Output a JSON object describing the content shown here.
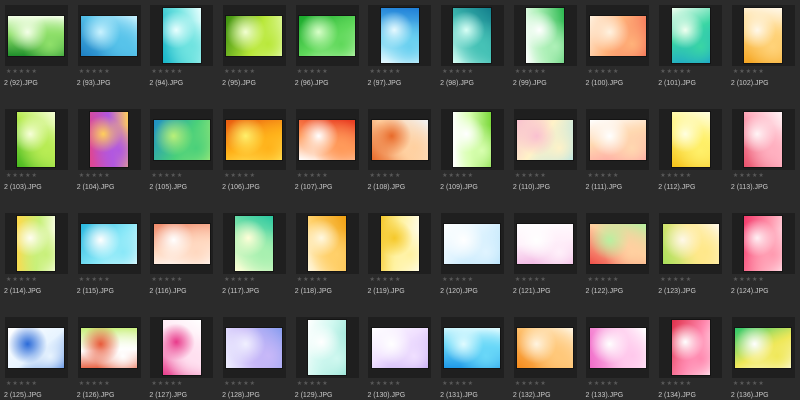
{
  "thumbnails": [
    {
      "name": "2 (92).JPG",
      "o": "l",
      "c": [
        "#1f8f2b",
        "#8fe06a",
        "#f4ffe8"
      ]
    },
    {
      "name": "2 (93).JPG",
      "o": "l",
      "c": [
        "#1d7fc4",
        "#57c3ea",
        "#c9f2ff"
      ]
    },
    {
      "name": "2 (94).JPG",
      "o": "p",
      "c": [
        "#16b5c9",
        "#6fe3e0",
        "#e8ffff"
      ]
    },
    {
      "name": "2 (95).JPG",
      "o": "l",
      "c": [
        "#3c8f10",
        "#b9e83a",
        "#f2ffd0"
      ]
    },
    {
      "name": "2 (96).JPG",
      "o": "l",
      "c": [
        "#17a82a",
        "#5fd85a",
        "#d8ffc8"
      ]
    },
    {
      "name": "2 (97).JPG",
      "o": "p",
      "c": [
        "#1f7fd8",
        "#6ad0f0",
        "#e6f9ff"
      ]
    },
    {
      "name": "2 (98).JPG",
      "o": "p",
      "c": [
        "#127f8c",
        "#46c2b6",
        "#d8fff6"
      ]
    },
    {
      "name": "2 (99).JPG",
      "o": "p",
      "c": [
        "#2ab84e",
        "#aef0b8",
        "#ffffff"
      ]
    },
    {
      "name": "2 (100).JPG",
      "o": "l",
      "c": [
        "#f05a4a",
        "#ffb27a",
        "#fff2e0"
      ]
    },
    {
      "name": "2 (101).JPG",
      "o": "p",
      "c": [
        "#1496d6",
        "#3ad6a4",
        "#f0fff0"
      ]
    },
    {
      "name": "2 (102).JPG",
      "o": "p",
      "c": [
        "#f5a623",
        "#ffd37a",
        "#fff8ea"
      ]
    },
    {
      "name": "2 (103).JPG",
      "o": "p",
      "c": [
        "#46b81e",
        "#b8ec54",
        "#f7ffd8"
      ]
    },
    {
      "name": "2 (104).JPG",
      "o": "p",
      "c": [
        "#e0458f",
        "#b158e0",
        "#ffcf5a"
      ]
    },
    {
      "name": "2 (105).JPG",
      "o": "l",
      "c": [
        "#1e8fc8",
        "#4ad07a",
        "#b9f078"
      ]
    },
    {
      "name": "2 (106).JPG",
      "o": "l",
      "c": [
        "#e85a10",
        "#ffb21a",
        "#fff06a"
      ]
    },
    {
      "name": "2 (107).JPG",
      "o": "l",
      "c": [
        "#e83a20",
        "#ff9a5a",
        "#ffffff"
      ]
    },
    {
      "name": "2 (108).JPG",
      "o": "l",
      "c": [
        "#f2f2f2",
        "#ffd0a0",
        "#e86a2a"
      ]
    },
    {
      "name": "2 (109).JPG",
      "o": "p",
      "c": [
        "#7ad83a",
        "#d8ffb0",
        "#ffffff"
      ]
    },
    {
      "name": "2 (110).JPG",
      "o": "l",
      "c": [
        "#9ae0f0",
        "#fff2c8",
        "#f9c0d0"
      ]
    },
    {
      "name": "2 (111).JPG",
      "o": "l",
      "c": [
        "#ff9aa0",
        "#ffd8b0",
        "#ffffff"
      ]
    },
    {
      "name": "2 (112).JPG",
      "o": "p",
      "c": [
        "#f5c21a",
        "#fff06a",
        "#ffffe0"
      ]
    },
    {
      "name": "2 (113).JPG",
      "o": "p",
      "c": [
        "#e8506a",
        "#ffb0c0",
        "#fff4f6"
      ]
    },
    {
      "name": "2 (114).JPG",
      "o": "p",
      "c": [
        "#ffd84a",
        "#c8f07a",
        "#fffef0"
      ]
    },
    {
      "name": "2 (115).JPG",
      "o": "l",
      "c": [
        "#28b8e0",
        "#8ae8f8",
        "#ffffff"
      ]
    },
    {
      "name": "2 (116).JPG",
      "o": "l",
      "c": [
        "#f08a6a",
        "#ffd8c0",
        "#ffffff"
      ]
    },
    {
      "name": "2 (117).JPG",
      "o": "p",
      "c": [
        "#2ac8a0",
        "#a8f0b0",
        "#ffffd8"
      ]
    },
    {
      "name": "2 (118).JPG",
      "o": "p",
      "c": [
        "#f0a010",
        "#ffd06a",
        "#fff8e0"
      ]
    },
    {
      "name": "2 (119).JPG",
      "o": "p",
      "c": [
        "#ffffff",
        "#fff2a0",
        "#f5c82a"
      ]
    },
    {
      "name": "2 (120).JPG",
      "o": "l",
      "c": [
        "#a8dcf8",
        "#e0f4ff",
        "#ffffff"
      ]
    },
    {
      "name": "2 (121).JPG",
      "o": "l",
      "c": [
        "#f0b0e0",
        "#fff0fa",
        "#ffffff"
      ]
    },
    {
      "name": "2 (122).JPG",
      "o": "l",
      "c": [
        "#f0504a",
        "#ffd0a0",
        "#b8f0a0"
      ]
    },
    {
      "name": "2 (123).JPG",
      "o": "l",
      "c": [
        "#a8e05a",
        "#ffe88a",
        "#fff8e8"
      ]
    },
    {
      "name": "2 (124).JPG",
      "o": "p",
      "c": [
        "#f4386a",
        "#ff9ab0",
        "#fff0f4"
      ]
    },
    {
      "name": "2 (125).JPG",
      "o": "l",
      "c": [
        "#ffffff",
        "#e8f4ff",
        "#2a6ad8"
      ]
    },
    {
      "name": "2 (126).JPG",
      "o": "l",
      "c": [
        "#c8f07a",
        "#ffffff",
        "#e85a3a"
      ]
    },
    {
      "name": "2 (127).JPG",
      "o": "p",
      "c": [
        "#ffffff",
        "#ffe0f0",
        "#e83a8a"
      ]
    },
    {
      "name": "2 (128).JPG",
      "o": "l",
      "c": [
        "#8a9ef0",
        "#c8b8f8",
        "#f0f0ff"
      ]
    },
    {
      "name": "2 (129).JPG",
      "o": "p",
      "c": [
        "#8ae0d0",
        "#d0f8f0",
        "#ffffff"
      ]
    },
    {
      "name": "2 (130).JPG",
      "o": "l",
      "c": [
        "#b89af0",
        "#f0e0ff",
        "#ffffff"
      ]
    },
    {
      "name": "2 (131).JPG",
      "o": "l",
      "c": [
        "#1e98e8",
        "#6ad8f8",
        "#e0fbff"
      ]
    },
    {
      "name": "2 (132).JPG",
      "o": "l",
      "c": [
        "#f58a1a",
        "#ffc87a",
        "#fff4e0"
      ]
    },
    {
      "name": "2 (133).JPG",
      "o": "l",
      "c": [
        "#f06ac8",
        "#ffc8ec",
        "#ffffff"
      ]
    },
    {
      "name": "2 (134).JPG",
      "o": "p",
      "c": [
        "#e0304a",
        "#ff8ab0",
        "#ffffff"
      ]
    },
    {
      "name": "2 (136).JPG",
      "o": "l",
      "c": [
        "#2ac86a",
        "#f0e85a",
        "#ffffff"
      ]
    }
  ],
  "rating": "★★★★★"
}
